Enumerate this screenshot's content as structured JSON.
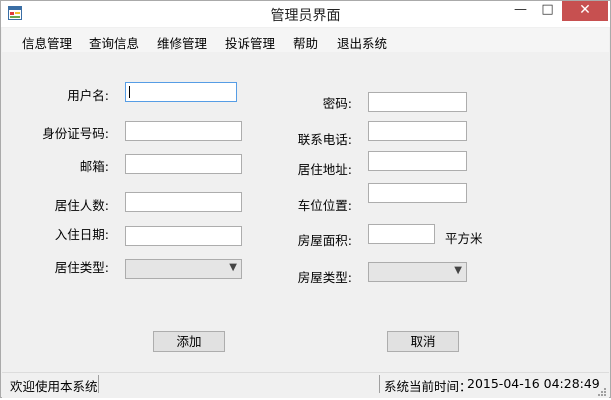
{
  "window": {
    "title": "管理员界面",
    "minimize_glyph": "—",
    "maximize_glyph": "□",
    "close_glyph": "✕"
  },
  "menu": [
    {
      "label": "信息管理"
    },
    {
      "label": "查询信息"
    },
    {
      "label": "维修管理"
    },
    {
      "label": "投诉管理"
    },
    {
      "label": "帮助"
    },
    {
      "label": "退出系统"
    }
  ],
  "form": {
    "left": {
      "username_label": "用户名:",
      "idcard_label": "身份证号码:",
      "email_label": "邮箱:",
      "residents_label": "居住人数:",
      "checkin_label": "入住日期:",
      "residence_type_label": "居住类型:"
    },
    "right": {
      "password_label": "密码:",
      "phone_label": "联系电话:",
      "address_label": "居住地址:",
      "parking_label": "车位位置:",
      "area_label": "房屋面积:",
      "area_unit": "平方米",
      "house_type_label": "房屋类型:"
    },
    "values": {
      "username": "",
      "idcard": "",
      "email": "",
      "residents": "",
      "checkin": "",
      "residence_type": "",
      "password": "",
      "phone": "",
      "address": "",
      "parking": "",
      "area": "",
      "house_type": ""
    }
  },
  "buttons": {
    "add": "添加",
    "cancel": "取消"
  },
  "status": {
    "welcome": "欢迎使用本系统",
    "time_label": "系统当前时间：",
    "time_value": "2015-04-16 04:28:49"
  },
  "colors": {
    "close_button": "#c75050",
    "focus_border": "#569de5"
  },
  "icons": {
    "app": "app-form-icon",
    "dropdown": "chevron-down-icon"
  }
}
